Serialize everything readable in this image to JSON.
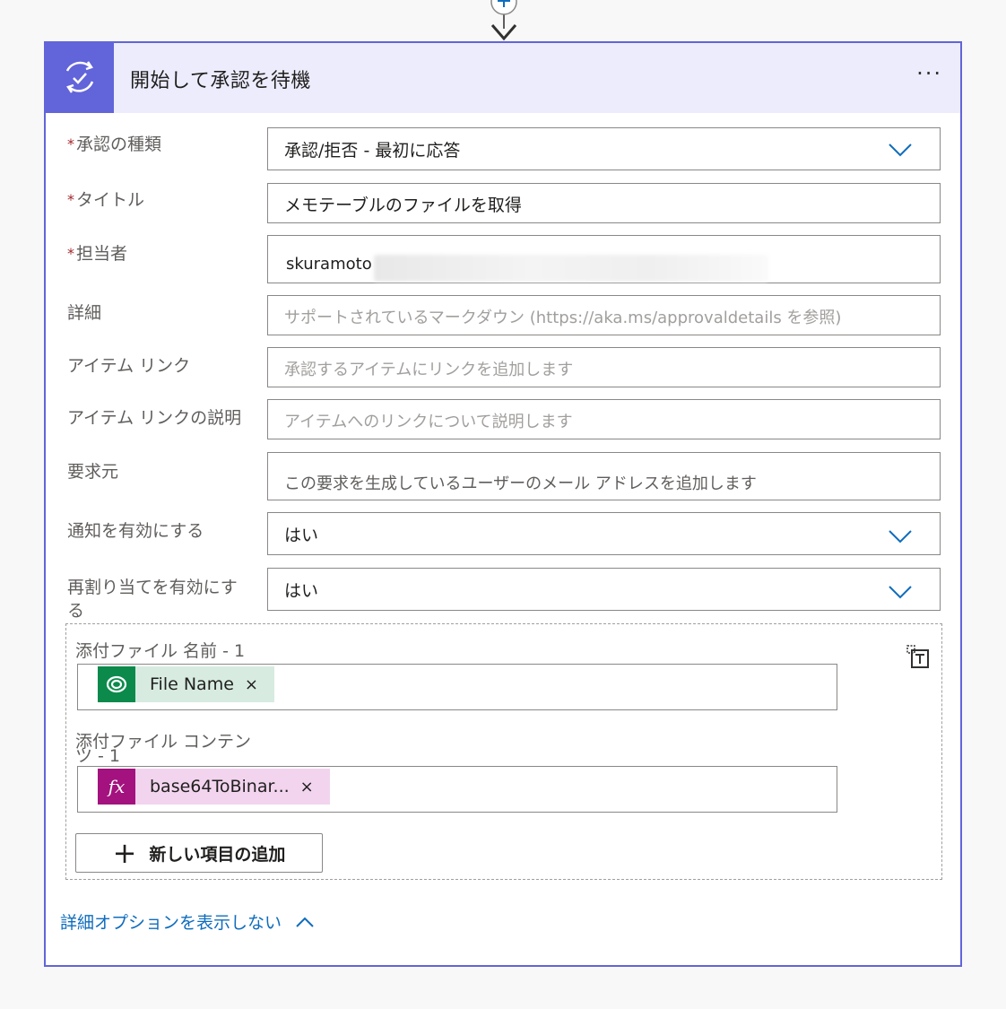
{
  "card": {
    "title": "開始して承認を待機",
    "more_label": "···"
  },
  "fields": {
    "approval_type": {
      "label": "承認の種類",
      "value": "承認/拒否 - 最初に応答"
    },
    "title": {
      "label": "タイトル",
      "value": "メモテーブルのファイルを取得"
    },
    "assigned_to": {
      "label": "担当者",
      "value": "skuramoto"
    },
    "details": {
      "label": "詳細",
      "placeholder": "サポートされているマークダウン (https://aka.ms/approvaldetails を参照)"
    },
    "item_link": {
      "label": "アイテム リンク",
      "placeholder": "承認するアイテムにリンクを追加します"
    },
    "item_link_desc": {
      "label": "アイテム リンクの説明",
      "placeholder": "アイテムへのリンクについて説明します"
    },
    "requestor": {
      "label": "要求元",
      "placeholder": "この要求を生成しているユーザーのメール アドレスを追加します"
    },
    "enable_notifications": {
      "label": "通知を有効にする",
      "value": "はい"
    },
    "enable_reassignment": {
      "label_line1": "再割り当てを有効にす",
      "label_line2": "る",
      "value": "はい"
    }
  },
  "attachments": {
    "name_label": "添付ファイル 名前 - 1",
    "name_token": {
      "label": "File Name",
      "close": "×",
      "icon": "dataverse-icon",
      "bg": "#d7ebe1",
      "icon_bg": "#0b8a4b"
    },
    "content_label_line1": "添付ファイル コンテン",
    "content_label_line2": "ツ - 1",
    "content_token": {
      "label": "base64ToBinar...",
      "close": "×",
      "icon": "fx",
      "bg": "#f2d4ee",
      "icon_bg": "#a3127e"
    },
    "add_button_label": "新しい項目の追加",
    "add_button_icon": "+"
  },
  "advanced_link": "詳細オプションを表示しない",
  "colors": {
    "accent": "#6264d9",
    "header_bg": "#ececfc",
    "link": "#0f6cbd",
    "chevron": "#0f6cbd",
    "required": "#a4262c"
  }
}
